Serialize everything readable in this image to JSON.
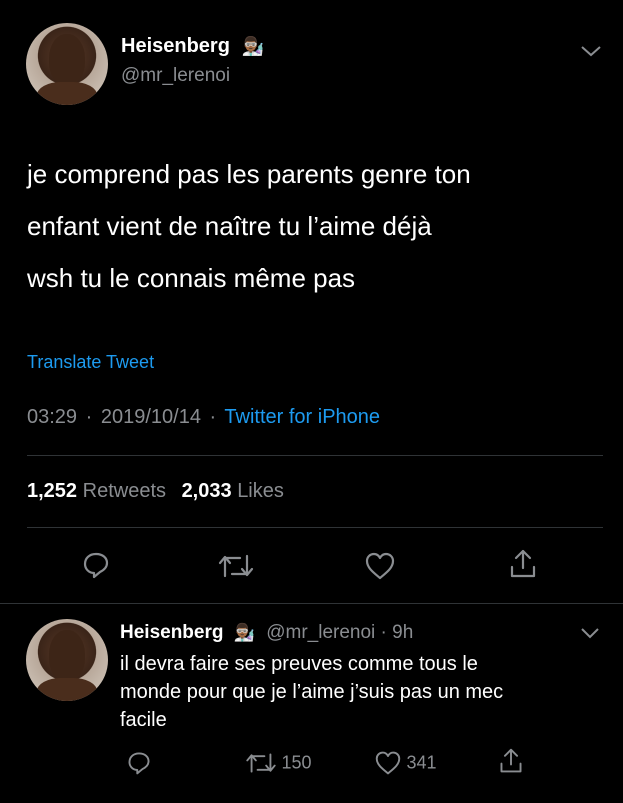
{
  "tweet": {
    "display_name": "Heisenberg",
    "name_emoji": "👨🏾‍🔬",
    "handle": "@mr_lerenoi",
    "text_lines": [
      "je comprend pas les parents genre ton",
      "enfant vient de naître tu l’aime déjà",
      "wsh tu le connais même pas"
    ],
    "translate_label": "Translate Tweet",
    "time": "03:29",
    "date": "2019/10/14",
    "separator": "·",
    "source": "Twitter for iPhone",
    "retweets_count": "1,252",
    "retweets_label": "Retweets",
    "likes_count": "2,033",
    "likes_label": "Likes"
  },
  "reply": {
    "display_name": "Heisenberg",
    "name_emoji": "👨🏾‍🔬",
    "handle_time": "@mr_lerenoi · 9h",
    "text_lines": [
      "il devra faire ses preuves comme tous le",
      "monde pour que je l’aime j’suis pas un mec",
      "facile"
    ],
    "retweet_count": "150",
    "like_count": "341"
  },
  "colors": {
    "background": "#000000",
    "text": "#ffffff",
    "muted": "#8a8d91",
    "link": "#1d9bf0",
    "divider": "#2f3336"
  }
}
